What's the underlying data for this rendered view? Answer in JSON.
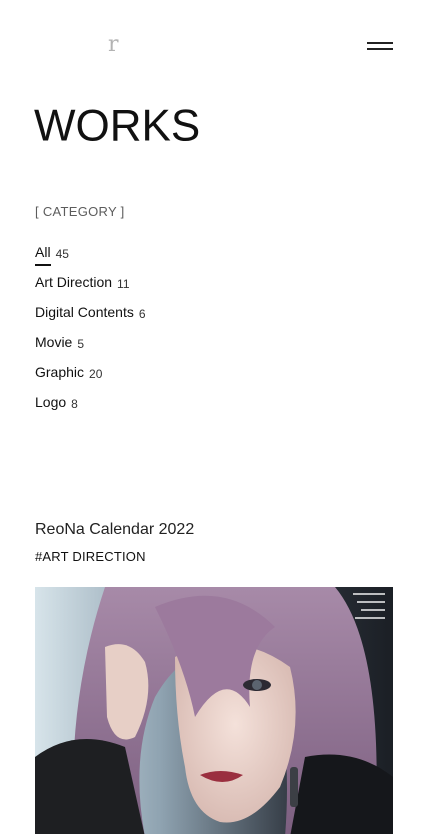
{
  "header": {
    "logo_text": "r",
    "menu_icon": "hamburger-menu-icon"
  },
  "page": {
    "title": "WORKS"
  },
  "categories": {
    "heading": "[ CATEGORY ]",
    "items": [
      {
        "name": "All",
        "count": "45",
        "active": true
      },
      {
        "name": "Art Direction",
        "count": "11",
        "active": false
      },
      {
        "name": "Digital Contents",
        "count": "6",
        "active": false
      },
      {
        "name": "Movie",
        "count": "5",
        "active": false
      },
      {
        "name": "Graphic",
        "count": "20",
        "active": false
      },
      {
        "name": "Logo",
        "count": "8",
        "active": false
      }
    ]
  },
  "featured_work": {
    "title": "ReoNa Calendar 2022",
    "tag": "#ART DIRECTION"
  }
}
